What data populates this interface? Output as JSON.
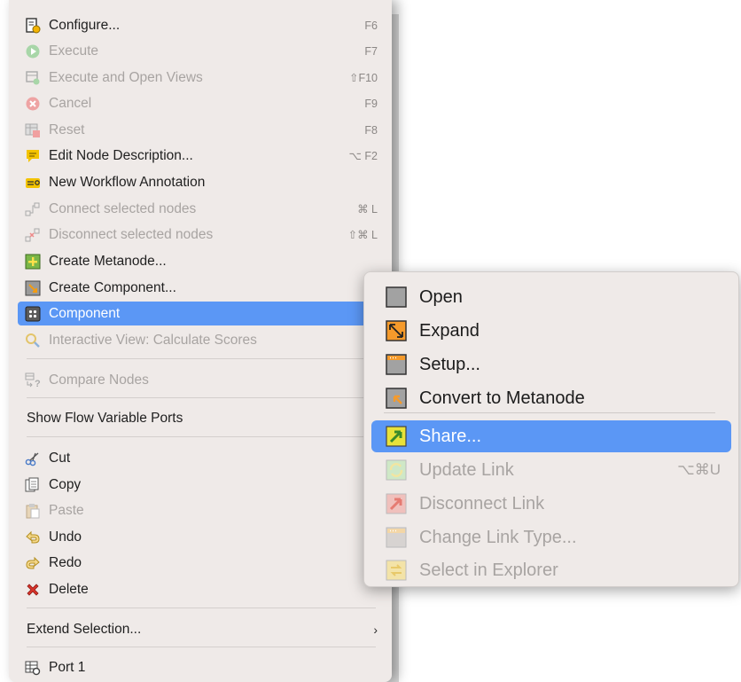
{
  "main_menu": {
    "items": [
      {
        "label": "Configure...",
        "shortcut": "F6",
        "icon": "configure-icon",
        "disabled": false
      },
      {
        "label": "Execute",
        "shortcut": "F7",
        "icon": "execute-icon",
        "disabled": true
      },
      {
        "label": "Execute and Open Views",
        "shortcut": "⇧F10",
        "icon": "execute-open-views-icon",
        "disabled": true
      },
      {
        "label": "Cancel",
        "shortcut": "F9",
        "icon": "cancel-icon",
        "disabled": true
      },
      {
        "label": "Reset",
        "shortcut": "F8",
        "icon": "reset-icon",
        "disabled": true
      },
      {
        "label": "Edit Node Description...",
        "shortcut": "⌥ F2",
        "icon": "note-icon",
        "disabled": false
      },
      {
        "label": "New Workflow Annotation",
        "shortcut": "",
        "icon": "annotation-icon",
        "disabled": false
      },
      {
        "label": "Connect selected nodes",
        "shortcut": "⌘ L",
        "icon": "connect-icon",
        "disabled": true
      },
      {
        "label": "Disconnect selected nodes",
        "shortcut": "⇧⌘ L",
        "icon": "disconnect-icon",
        "disabled": true
      },
      {
        "label": "Create Metanode...",
        "shortcut": "",
        "icon": "metanode-icon",
        "disabled": false
      },
      {
        "label": "Create Component...",
        "shortcut": "",
        "icon": "create-component-icon",
        "disabled": false
      },
      {
        "label": "Component",
        "shortcut": "",
        "icon": "component-icon",
        "disabled": false,
        "selected": true
      },
      {
        "label": "Interactive View: Calculate Scores",
        "shortcut": "",
        "icon": "magnifier-icon",
        "disabled": true
      },
      {
        "label": "Compare Nodes",
        "shortcut": "",
        "icon": "compare-icon",
        "disabled": true
      },
      {
        "label": "Show Flow Variable Ports",
        "shortcut": "",
        "icon": "",
        "disabled": false
      },
      {
        "label": "Cut",
        "shortcut": "",
        "icon": "scissors-icon",
        "disabled": false
      },
      {
        "label": "Copy",
        "shortcut": "",
        "icon": "copy-icon",
        "disabled": false
      },
      {
        "label": "Paste",
        "shortcut": "",
        "icon": "paste-icon",
        "disabled": true
      },
      {
        "label": "Undo",
        "shortcut": "",
        "icon": "undo-icon",
        "disabled": false
      },
      {
        "label": "Redo",
        "shortcut": "",
        "icon": "redo-icon",
        "disabled": false
      },
      {
        "label": "Delete",
        "shortcut": "",
        "icon": "delete-icon",
        "disabled": false
      },
      {
        "label": "Extend Selection...",
        "shortcut": "",
        "icon": "",
        "disabled": false,
        "submenu_arrow": "›"
      },
      {
        "label": "Port 1",
        "shortcut": "",
        "icon": "port-icon",
        "disabled": false
      }
    ]
  },
  "sub_menu": {
    "items": [
      {
        "label": "Open",
        "shortcut": "",
        "icon": "open-icon",
        "disabled": false
      },
      {
        "label": "Expand",
        "shortcut": "",
        "icon": "expand-icon",
        "disabled": false
      },
      {
        "label": "Setup...",
        "shortcut": "",
        "icon": "setup-icon",
        "disabled": false
      },
      {
        "label": "Convert to Metanode",
        "shortcut": "",
        "icon": "convert-icon",
        "disabled": false
      },
      {
        "label": "Share...",
        "shortcut": "",
        "icon": "share-icon",
        "disabled": false,
        "selected": true
      },
      {
        "label": "Update Link",
        "shortcut": "⌥⌘U",
        "icon": "update-link-icon",
        "disabled": true
      },
      {
        "label": "Disconnect Link",
        "shortcut": "",
        "icon": "disconnect-link-icon",
        "disabled": true
      },
      {
        "label": "Change Link Type...",
        "shortcut": "",
        "icon": "change-link-type-icon",
        "disabled": true
      },
      {
        "label": "Select in Explorer",
        "shortcut": "",
        "icon": "select-explorer-icon",
        "disabled": true
      }
    ]
  },
  "colors": {
    "menu_bg": "#efeae8",
    "selection": "#5b97f5",
    "disabled_text": "#a8a4a2"
  }
}
